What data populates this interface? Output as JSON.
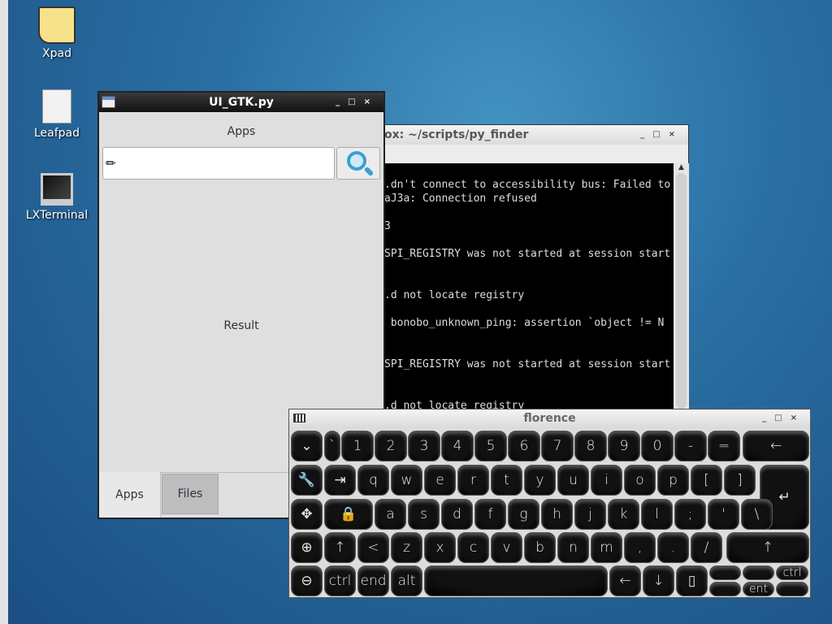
{
  "desktop": {
    "icons": [
      {
        "label": "Xpad",
        "icon": "sticky-note-icon"
      },
      {
        "label": "Leafpad",
        "icon": "text-editor-icon"
      },
      {
        "label": "LXTerminal",
        "icon": "monitor-icon"
      }
    ]
  },
  "gtk_window": {
    "title": "UI_GTK.py",
    "header_label": "Apps",
    "search_value": "",
    "result_label": "Result",
    "tabs": [
      {
        "label": "Apps",
        "active": true
      },
      {
        "label": "Files",
        "active": false
      }
    ]
  },
  "terminal": {
    "title": "ox: ~/scripts/py_finder",
    "lines": [
      ".dn't connect to accessibility bus: Failed to",
      "aJ3a: Connection refused",
      "",
      "3",
      "",
      "SPI_REGISTRY was not started at session start",
      "",
      "",
      ".d not locate registry",
      "",
      " bonobo_unknown_ping: assertion `object != N",
      "",
      "",
      "SPI_REGISTRY was not started at session start",
      "",
      "",
      ".d not locate registry"
    ]
  },
  "keyboard": {
    "title": "florence",
    "keys": [
      "⌄",
      "`",
      "1",
      "2",
      "3",
      "4",
      "5",
      "6",
      "7",
      "8",
      "9",
      "0",
      "-",
      "=",
      "←",
      "🔧",
      "⇥",
      "q",
      "w",
      "e",
      "r",
      "t",
      "y",
      "u",
      "i",
      "o",
      "p",
      "[",
      "]",
      "↵",
      "✥",
      "🔒",
      "a",
      "s",
      "d",
      "f",
      "g",
      "h",
      "j",
      "k",
      "l",
      ";",
      "'",
      "\\",
      "⊕",
      "↑",
      "<",
      "z",
      "x",
      "c",
      "v",
      "b",
      "n",
      "m",
      ",",
      ".",
      "/",
      "↑",
      "⊖",
      "ctrl",
      "end",
      "alt",
      "",
      "←",
      "↓",
      "▯",
      "",
      "",
      "",
      "ctrl",
      "ent",
      ""
    ]
  }
}
